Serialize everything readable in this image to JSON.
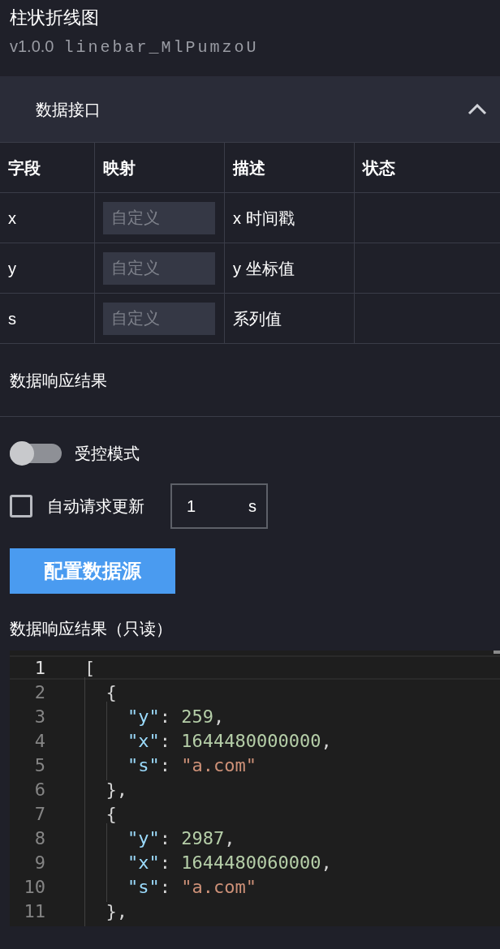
{
  "title": "柱状折线图",
  "version": "v1.0.0",
  "component_id": "linebar_MlPumzoU",
  "section": {
    "title": "数据接口",
    "expanded": true
  },
  "table": {
    "columns": [
      "字段",
      "映射",
      "描述",
      "状态"
    ],
    "rows": [
      {
        "field": "x",
        "mapping_placeholder": "自定义",
        "description": "x 时间戳"
      },
      {
        "field": "y",
        "mapping_placeholder": "自定义",
        "description": "y 坐标值"
      },
      {
        "field": "s",
        "mapping_placeholder": "自定义",
        "description": "系列值"
      }
    ]
  },
  "response_heading": "数据响应结果",
  "controlled_mode": {
    "label": "受控模式",
    "on": false
  },
  "auto_update": {
    "label": "自动请求更新",
    "checked": false,
    "value": "1",
    "unit": "s"
  },
  "configure_button": "配置数据源",
  "readonly_label": "数据响应结果（只读）",
  "code_lines": [
    {
      "number": "1",
      "active": true,
      "tokens": [
        {
          "kind": "punct",
          "text": "["
        }
      ]
    },
    {
      "number": "2",
      "active": false,
      "tokens": [
        {
          "kind": "punct",
          "text": "  {"
        }
      ]
    },
    {
      "number": "3",
      "active": false,
      "tokens": [
        {
          "kind": "key",
          "text": "    \"y\""
        },
        {
          "kind": "punct",
          "text": ": "
        },
        {
          "kind": "number",
          "text": "259"
        },
        {
          "kind": "punct",
          "text": ","
        }
      ]
    },
    {
      "number": "4",
      "active": false,
      "tokens": [
        {
          "kind": "key",
          "text": "    \"x\""
        },
        {
          "kind": "punct",
          "text": ": "
        },
        {
          "kind": "number",
          "text": "1644480000000"
        },
        {
          "kind": "punct",
          "text": ","
        }
      ]
    },
    {
      "number": "5",
      "active": false,
      "tokens": [
        {
          "kind": "key",
          "text": "    \"s\""
        },
        {
          "kind": "punct",
          "text": ": "
        },
        {
          "kind": "string",
          "text": "\"a.com\""
        }
      ]
    },
    {
      "number": "6",
      "active": false,
      "tokens": [
        {
          "kind": "punct",
          "text": "  },"
        }
      ]
    },
    {
      "number": "7",
      "active": false,
      "tokens": [
        {
          "kind": "punct",
          "text": "  {"
        }
      ]
    },
    {
      "number": "8",
      "active": false,
      "tokens": [
        {
          "kind": "key",
          "text": "    \"y\""
        },
        {
          "kind": "punct",
          "text": ": "
        },
        {
          "kind": "number",
          "text": "2987"
        },
        {
          "kind": "punct",
          "text": ","
        }
      ]
    },
    {
      "number": "9",
      "active": false,
      "tokens": [
        {
          "kind": "key",
          "text": "    \"x\""
        },
        {
          "kind": "punct",
          "text": ": "
        },
        {
          "kind": "number",
          "text": "1644480060000"
        },
        {
          "kind": "punct",
          "text": ","
        }
      ]
    },
    {
      "number": "10",
      "active": false,
      "tokens": [
        {
          "kind": "key",
          "text": "    \"s\""
        },
        {
          "kind": "punct",
          "text": ": "
        },
        {
          "kind": "string",
          "text": "\"a.com\""
        }
      ]
    },
    {
      "number": "11",
      "active": false,
      "tokens": [
        {
          "kind": "punct",
          "text": "  },"
        }
      ]
    }
  ]
}
